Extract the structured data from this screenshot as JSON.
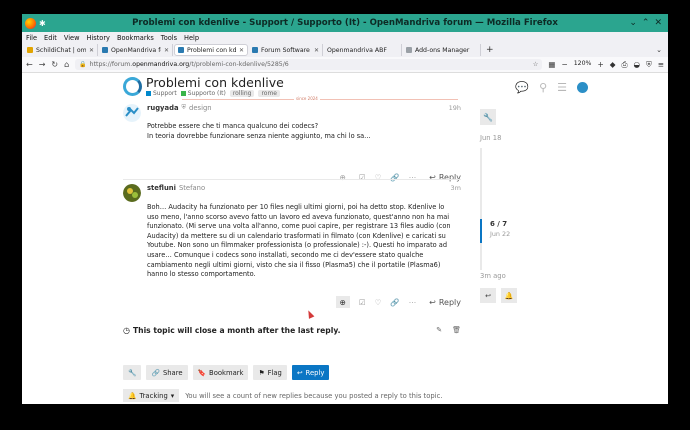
{
  "window": {
    "title": "Problemi con kdenlive - Support / Supporto (It) - OpenMandriva forum — Mozilla Firefox",
    "controls": [
      "⌄",
      "⌃",
      "✕"
    ]
  },
  "menubar": [
    "File",
    "Edit",
    "View",
    "History",
    "Bookmarks",
    "Tools",
    "Help"
  ],
  "tabs": [
    {
      "label": "SchildiChat | om-dev",
      "active": false
    },
    {
      "label": "OpenMandriva forum",
      "active": false
    },
    {
      "label": "Problemi con kdenlive",
      "active": true
    },
    {
      "label": "Forum Software - Oth",
      "active": false
    },
    {
      "label": "Openmandriva ABF",
      "active": false
    },
    {
      "label": "Add-ons Manager",
      "active": false
    }
  ],
  "nav": {
    "url_prefix": "https://forum.",
    "url_host": "openmandriva.org",
    "url_path": "/t/problemi-con-kdenlive/5285/6",
    "zoom": "120%"
  },
  "topic": {
    "title": "Problemi con kdenlive",
    "category_1": "Support",
    "category_2": "Supporto (It)",
    "tags": [
      "rolling",
      "rome"
    ],
    "category_1_color": "#0088cc",
    "category_2_color": "#3ab54a"
  },
  "gap_label": "since 2024",
  "posts": [
    {
      "username": "rugyada",
      "title": "design",
      "age": "19h",
      "lines": [
        "Potrebbe essere che ti manca qualcuno dei codecs?",
        "In teoria dovrebbe funzionare senza niente aggiunto, ma chi lo sa…"
      ],
      "reply_label": "Reply"
    },
    {
      "username": "stefluni",
      "fullname": "Stefano",
      "age": "3m",
      "lines": [
        "Boh… Audacity ha funzionato per 10 files negli ultimi giorni, poi ha detto stop. Kdenlive lo",
        "uso meno, l'anno scorso avevo fatto un lavoro ed aveva funzionato, quest'anno non ha mai",
        "funzionato. (Mi serve una volta all'anno, come puoi capire, per registrare 13 files audio (con",
        "Audacity) da mettere su di un calendario trasformati in filmato (con Kdenlive) e caricati su",
        "Youtube. Non sono un filmmaker professionista (o professionale) :-). Questi ho imparato ad",
        "usare… Comunque i codecs sono installati, secondo me ci dev'essere stato qualche",
        "cambiamento negli ultimi giorni, visto che sia il fisso (Plasma5) che il portatile (Plasma6)",
        "hanno lo stesso comportamento."
      ],
      "reply_label": "Reply"
    }
  ],
  "notice": "This topic will close a month after the last reply.",
  "footer_buttons": [
    "Share",
    "Bookmark",
    "Flag",
    "Reply"
  ],
  "tracking": {
    "label": "Tracking",
    "description": "You will see a count of new replies because you posted a reply to this topic."
  },
  "timeline": {
    "start_date": "Jun 18",
    "position": "6 / 7",
    "position_date": "Jun 22",
    "last_activity": "3m ago"
  }
}
